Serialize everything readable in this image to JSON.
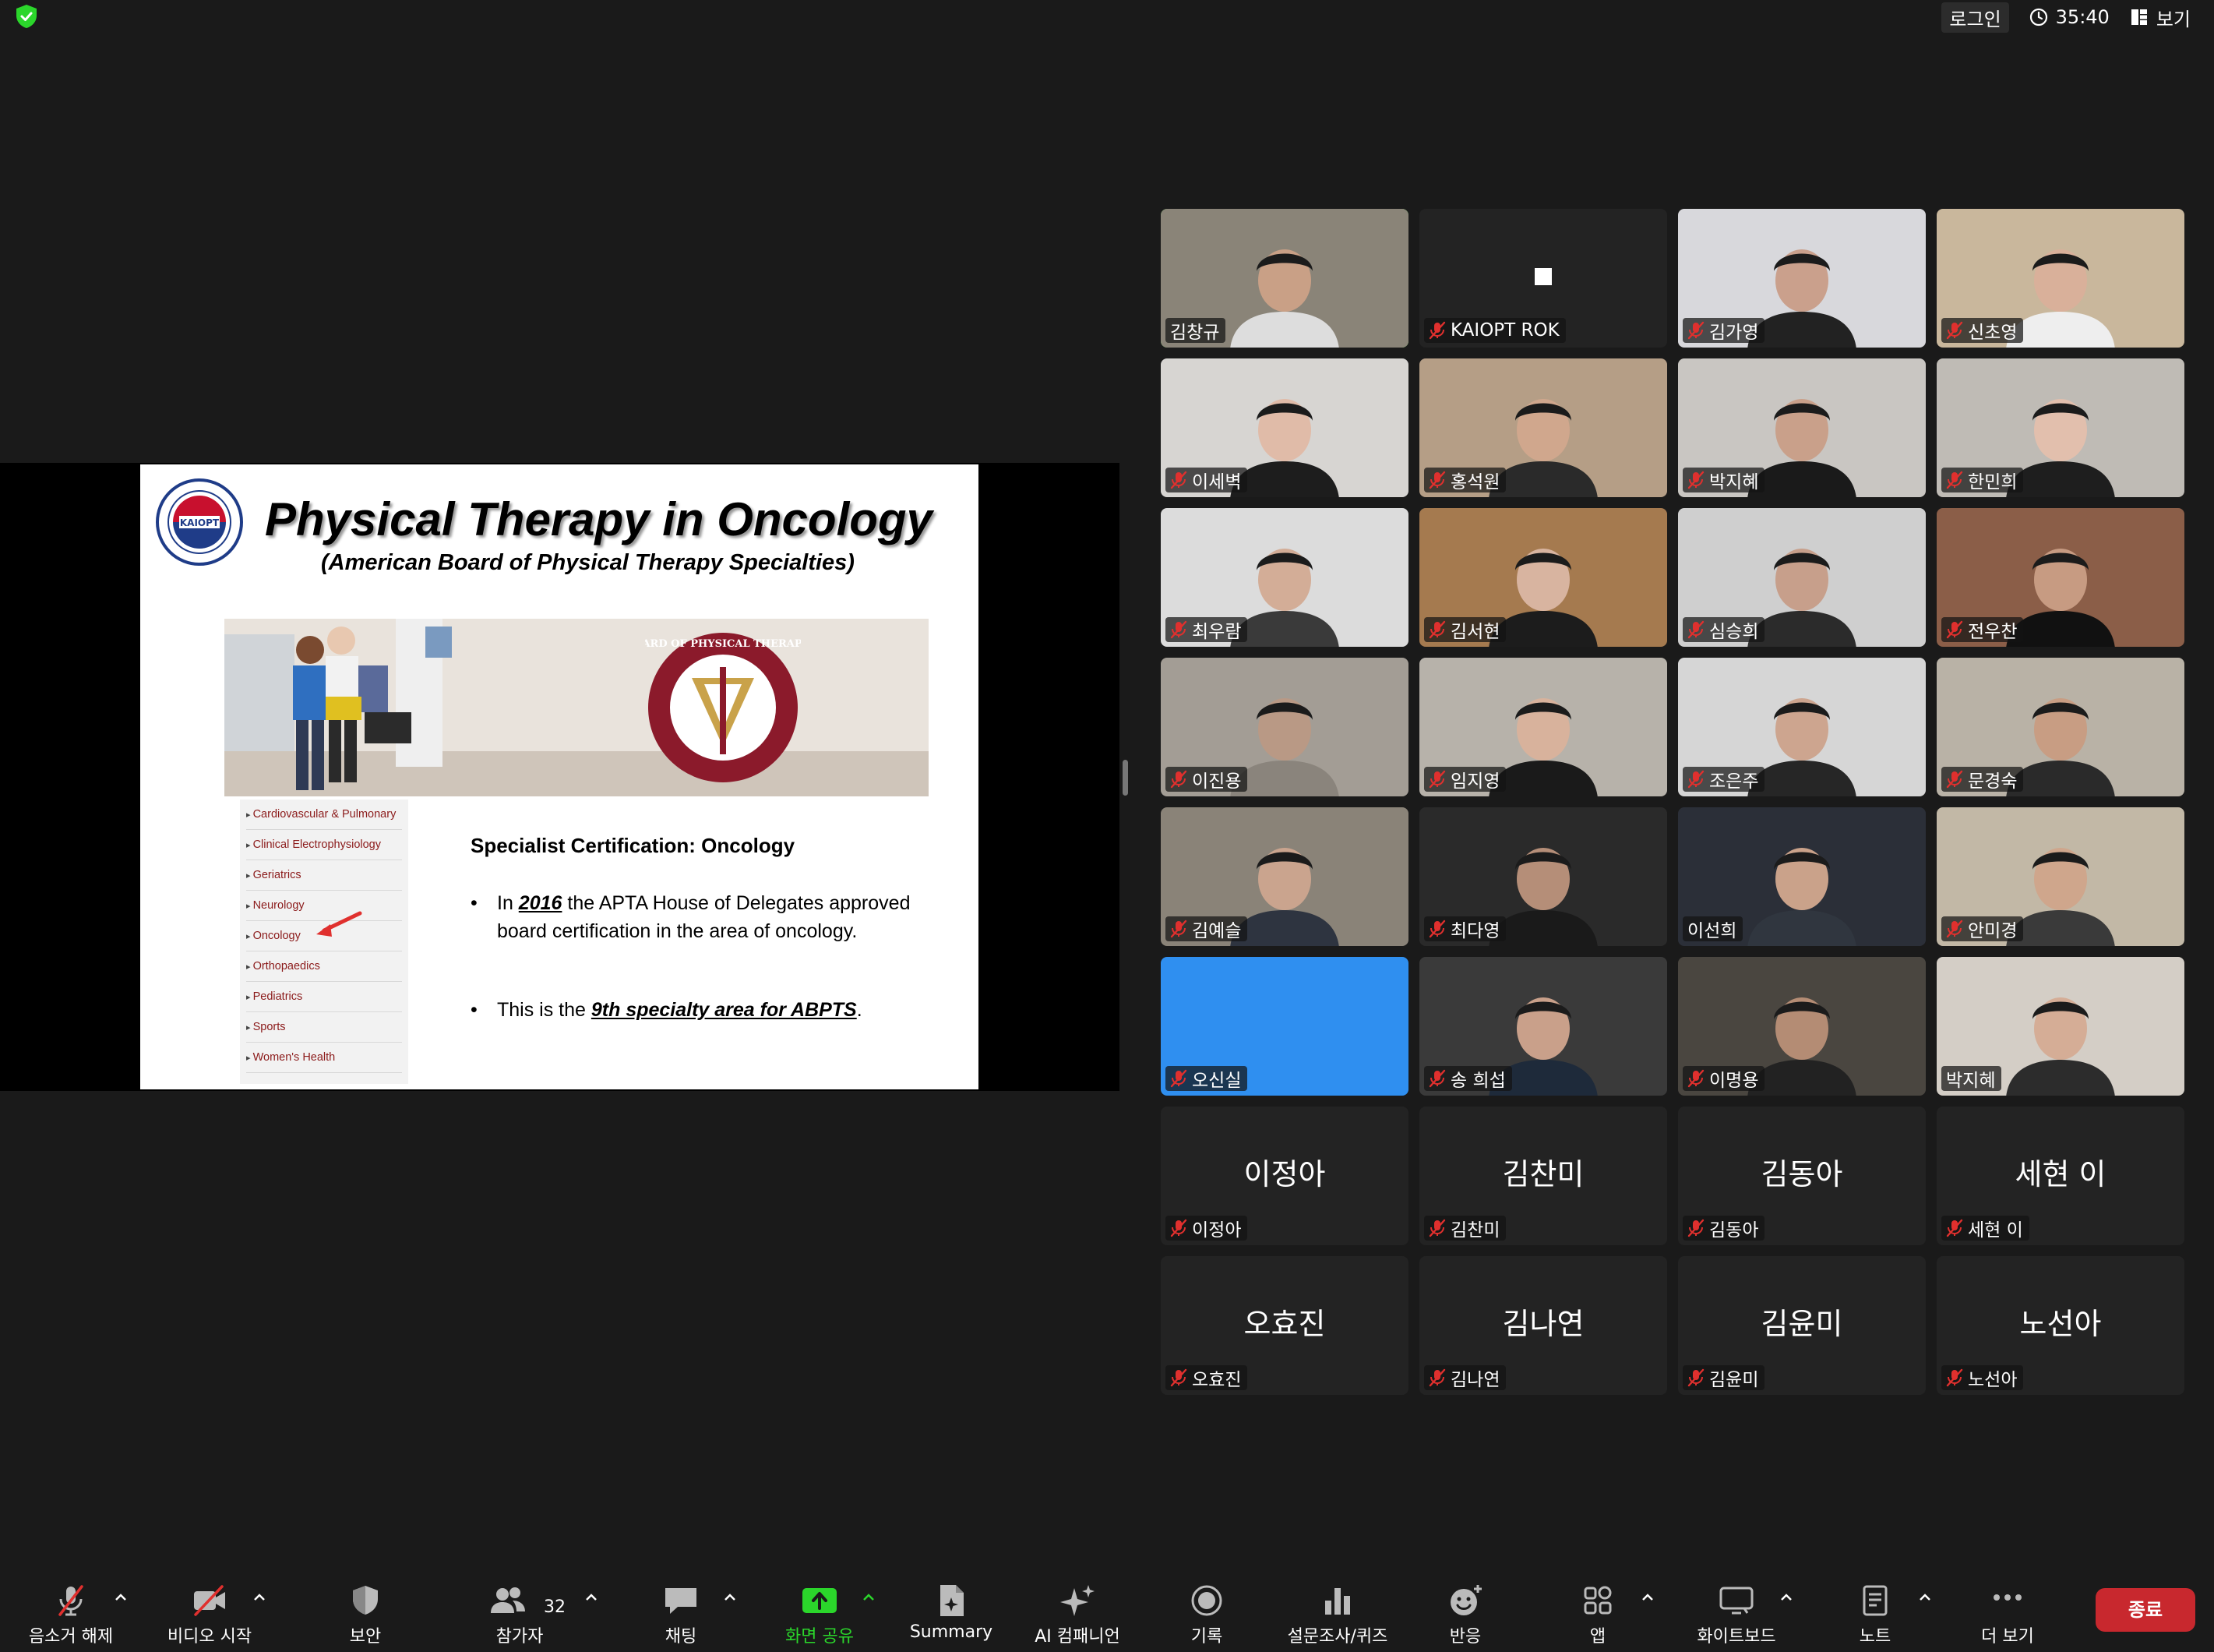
{
  "topbar": {
    "login": "로그인",
    "timer": "35:40",
    "view": "보기",
    "icons": [
      "security-shield-icon",
      "clock-icon",
      "grid-view-icon"
    ]
  },
  "slide": {
    "title": "Physical Therapy in Oncology",
    "subtitle": "(American Board of Physical Therapy Specialties)",
    "logo_text": "KAIOPT",
    "seal_text": "AMERICAN BOARD OF PHYSICAL THERAPY SPECIALTIES",
    "specialties": [
      "Cardiovascular & Pulmonary",
      "Clinical Electrophysiology",
      "Geriatrics",
      "Neurology",
      "Oncology",
      "Orthopaedics",
      "Pediatrics",
      "Sports",
      "Women's Health"
    ],
    "cert_title": "Specialist Certification: Oncology",
    "bullet1_pre": "In ",
    "bullet1_year": "2016",
    "bullet1_post": " the APTA House of Delegates approved board certification in the area of oncology.",
    "bullet2_pre": "This is the ",
    "bullet2_em": "9th specialty area for ABPTS",
    "bullet2_post": "."
  },
  "participants": [
    {
      "name": "김창규",
      "muted": false,
      "video": true,
      "bg": "#8a8478",
      "skin": "#c9a086",
      "shirt": "#dddddd",
      "active": true
    },
    {
      "name": "KAIOPT ROK",
      "muted": true,
      "video": false,
      "bg": "#232323"
    },
    {
      "name": "김가영",
      "muted": true,
      "video": true,
      "bg": "#d8d8dc",
      "skin": "#caa08c",
      "shirt": "#222222"
    },
    {
      "name": "신초영",
      "muted": true,
      "video": true,
      "bg": "#c9b79c",
      "skin": "#d9b09a",
      "shirt": "#eeeeee"
    },
    {
      "name": "이세벽",
      "muted": true,
      "video": true,
      "bg": "#d7d5d2",
      "skin": "#e0bba8",
      "shirt": "#1d1d1d"
    },
    {
      "name": "홍석원",
      "muted": true,
      "video": true,
      "bg": "#b59e86",
      "skin": "#d0a78d",
      "shirt": "#2a2a2a"
    },
    {
      "name": "박지혜",
      "muted": true,
      "video": true,
      "bg": "#c9c6c2",
      "skin": "#c9a08a",
      "shirt": "#1a1a1a"
    },
    {
      "name": "한민희",
      "muted": true,
      "video": true,
      "bg": "#bfbbb5",
      "skin": "#e2bfad",
      "shirt": "#1e1e1e"
    },
    {
      "name": "최우람",
      "muted": true,
      "video": true,
      "bg": "#dcdcdc",
      "skin": "#d3ad97",
      "shirt": "#3a3a3a"
    },
    {
      "name": "김서현",
      "muted": true,
      "video": true,
      "bg": "#a57a4f",
      "skin": "#d8b4a0",
      "shirt": "#1c1c1c"
    },
    {
      "name": "심승희",
      "muted": true,
      "video": true,
      "bg": "#cfcfcf",
      "skin": "#c79f8b",
      "shirt": "#2b2b2b"
    },
    {
      "name": "전우찬",
      "muted": true,
      "video": true,
      "bg": "#8b5e48",
      "skin": "#c79b82",
      "shirt": "#111111"
    },
    {
      "name": "이진용",
      "muted": true,
      "video": true,
      "bg": "#a39d95",
      "skin": "#b99985",
      "shirt": "#8a847c"
    },
    {
      "name": "임지영",
      "muted": true,
      "video": true,
      "bg": "#b7b2aa",
      "skin": "#d8b29c",
      "shirt": "#1a1a1a"
    },
    {
      "name": "조은주",
      "muted": true,
      "video": true,
      "bg": "#d6d6d6",
      "skin": "#cda58f",
      "shirt": "#262626"
    },
    {
      "name": "문경숙",
      "muted": true,
      "video": true,
      "bg": "#b9b2a6",
      "skin": "#c89d83",
      "shirt": "#2a2a2a"
    },
    {
      "name": "김예슬",
      "muted": true,
      "video": true,
      "bg": "#8a8378",
      "skin": "#caa48e",
      "shirt": "#2e3440"
    },
    {
      "name": "최다영",
      "muted": true,
      "video": true,
      "bg": "#2a2a2a",
      "skin": "#b58e78",
      "shirt": "#1a1a1a"
    },
    {
      "name": "이선희",
      "muted": false,
      "video": true,
      "bg": "#2b2f38",
      "skin": "#caa28a",
      "shirt": "#30363f"
    },
    {
      "name": "안미경",
      "muted": true,
      "video": true,
      "bg": "#c2b8a6",
      "skin": "#cfa68c",
      "shirt": "#3a3a3a"
    },
    {
      "name": "오신실",
      "muted": true,
      "video": true,
      "bg": "#2f8ff0",
      "avatar": false
    },
    {
      "name": "송 희섭",
      "muted": true,
      "video": true,
      "bg": "#3a3a3a",
      "skin": "#c9a08a",
      "shirt": "#1e2a3a"
    },
    {
      "name": "이명용",
      "muted": true,
      "video": true,
      "bg": "#4a4640",
      "skin": "#b48c74",
      "shirt": "#222222"
    },
    {
      "name": "박지혜",
      "muted": false,
      "video": true,
      "bg": "#d4cec6",
      "skin": "#d5ad96",
      "shirt": "#2c2c2c"
    },
    {
      "name": "이정아",
      "muted": true,
      "video": false
    },
    {
      "name": "김찬미",
      "muted": true,
      "video": false
    },
    {
      "name": "김동아",
      "muted": true,
      "video": false
    },
    {
      "name": "세현 이",
      "muted": true,
      "video": false
    },
    {
      "name": "오효진",
      "muted": true,
      "video": false
    },
    {
      "name": "김나연",
      "muted": true,
      "video": false
    },
    {
      "name": "김윤미",
      "muted": true,
      "video": false
    },
    {
      "name": "노선아",
      "muted": true,
      "video": false
    }
  ],
  "toolbar": {
    "unmute": "음소거 해제",
    "start_video": "비디오 시작",
    "security": "보안",
    "participants": "참가자",
    "participants_count": "32",
    "chat": "채팅",
    "share_screen": "화면 공유",
    "summary": "Summary",
    "ai_companion": "AI 컴패니언",
    "record": "기록",
    "polls": "설문조사/퀴즈",
    "reactions": "반응",
    "apps": "앱",
    "whiteboard": "화이트보드",
    "notes": "노트",
    "more": "더 보기",
    "end": "종료"
  },
  "colors": {
    "accent_green": "#2bd62b",
    "end_red": "#c8282e",
    "muted_red": "#e0302e"
  }
}
